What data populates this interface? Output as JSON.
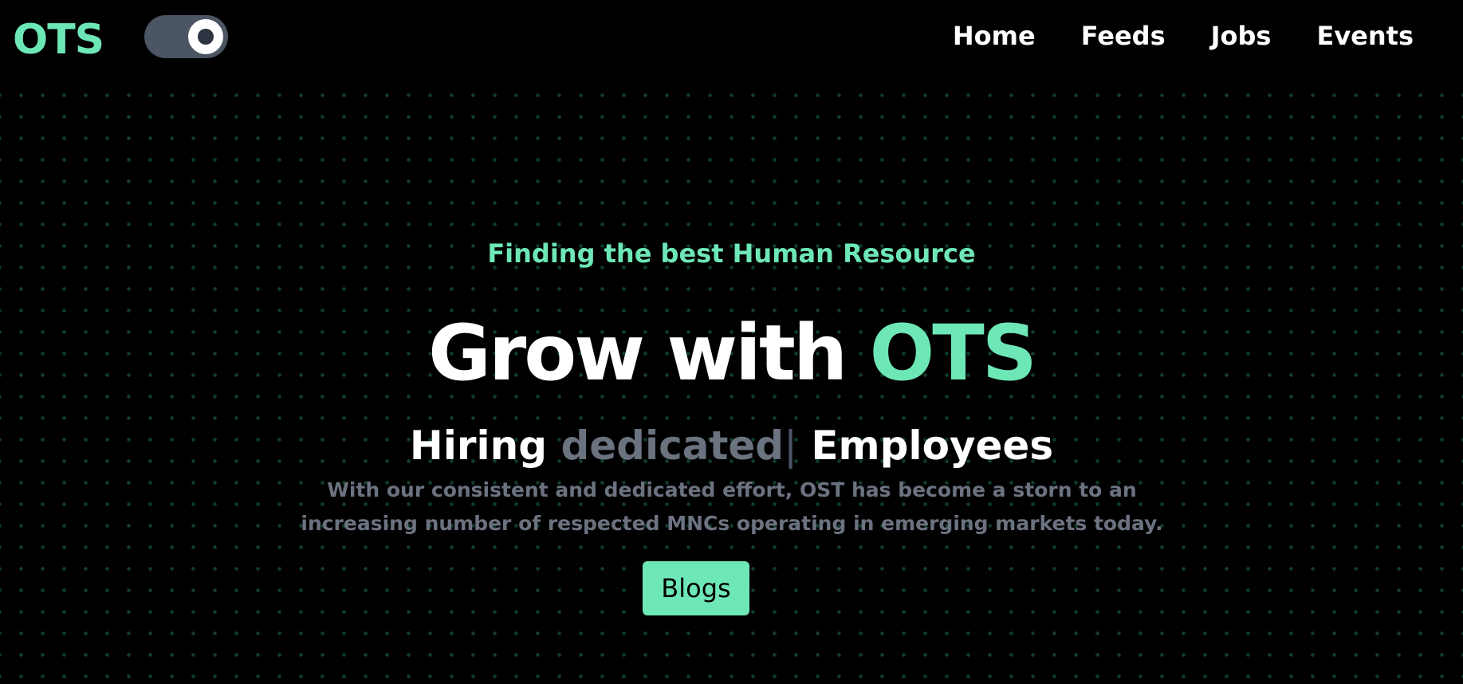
{
  "header": {
    "logo": "OTS",
    "theme_toggle": {
      "state": "on"
    },
    "nav": [
      {
        "label": "Home"
      },
      {
        "label": "Feeds"
      },
      {
        "label": "Jobs"
      },
      {
        "label": "Events"
      }
    ]
  },
  "hero": {
    "tagline": "Finding the best Human Resource",
    "headline_prefix": "Grow with",
    "headline_accent": "OTS",
    "subhead_prefix": "Hiring",
    "subhead_typed": "dedicated",
    "subhead_cursor": "|",
    "subhead_suffix": "Employees",
    "description": "With our consistent and dedicated effort, OST has become a storn to an increasing number of respected MNCs operating in emerging markets today.",
    "cta_label": "Blogs"
  },
  "colors": {
    "background": "#000000",
    "accent": "#6ee7b7",
    "muted_text": "#6b7280",
    "dot_pattern": "#0f3d2c",
    "toggle_track": "#4b5563"
  },
  "icons": {
    "theme_toggle": "toggle-switch-icon"
  }
}
